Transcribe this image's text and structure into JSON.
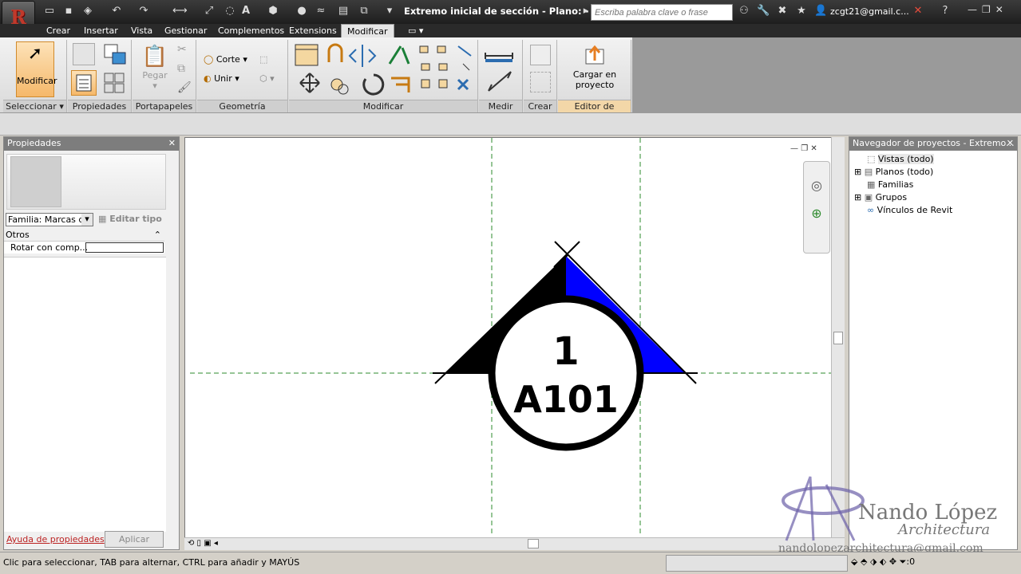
{
  "titlebar": {
    "doc_title": "Extremo inicial de sección - Plano: -",
    "search_placeholder": "Escriba palabra clave o frase",
    "user": "zcgt21@gmail.c..."
  },
  "tabs": [
    "Crear",
    "Insertar",
    "Vista",
    "Gestionar",
    "Complementos",
    "Extensions",
    "Modificar"
  ],
  "active_tab": "Modificar",
  "ribbon": {
    "modify_label": "Modificar",
    "panels": {
      "seleccionar": "Seleccionar",
      "propiedades": "Propiedades",
      "portapapeles": "Portapapeles",
      "geometria": "Geometría",
      "modificar": "Modificar",
      "medir": "Medir",
      "crear": "Crear",
      "editor": "Editor de familias"
    },
    "paste_label": "Pegar",
    "corte_label": "Corte",
    "unir_label": "Unir",
    "load_label_1": "Cargar en",
    "load_label_2": "proyecto"
  },
  "properties": {
    "title": "Propiedades",
    "family_select": "Familia: Marcas d",
    "edit_type": "Editar tipo",
    "group": "Otros",
    "param_name": "Rotar con comp...",
    "help_link": "Ayuda de propiedades",
    "apply": "Aplicar"
  },
  "canvas": {
    "sheet_number": "1",
    "detail_label": "A101",
    "accent_color": "#0000ff"
  },
  "navigator": {
    "title": "Navegador de proyectos - Extremo...",
    "items": [
      "Vistas (todo)",
      "Planos (todo)",
      "Familias",
      "Grupos",
      "Vínculos de Revit"
    ]
  },
  "watermark": {
    "name": "Nando López",
    "subtitle": "Architectura",
    "email": "nandolopezarchitectura@gmail.com"
  },
  "status": {
    "message": "Clic para seleccionar, TAB para alternar, CTRL para añadir y MAYÚS",
    "filter_count": ":0"
  }
}
